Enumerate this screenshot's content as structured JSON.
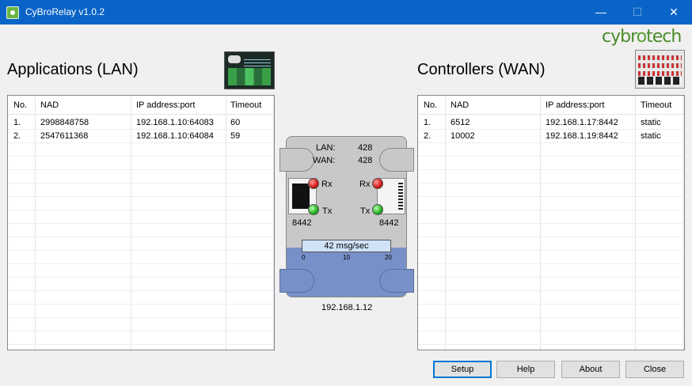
{
  "window": {
    "title": "CyBroRelay v1.0.2",
    "minimize": "—",
    "maximize": "☐",
    "close": "✕"
  },
  "brand": {
    "logo_a": "cybr",
    "logo_o": "o",
    "logo_b": "tech"
  },
  "lan": {
    "title": "Applications (LAN)",
    "columns": [
      "No.",
      "NAD",
      "IP address:port",
      "Timeout"
    ],
    "rows": [
      [
        "1.",
        "2998848758",
        "192.168.1.10:64083",
        "60"
      ],
      [
        "2.",
        "2547611368",
        "192.168.1.10:64084",
        "59"
      ]
    ]
  },
  "wan": {
    "title": "Controllers (WAN)",
    "columns": [
      "No.",
      "NAD",
      "IP address:port",
      "Timeout"
    ],
    "rows": [
      [
        "1.",
        "6512",
        "192.168.1.17:8442",
        "static"
      ],
      [
        "2.",
        "10002",
        "192.168.1.19:8442",
        "static"
      ]
    ]
  },
  "device": {
    "lan_label": "LAN:",
    "lan_value": "428",
    "wan_label": "WAN:",
    "wan_value": "428",
    "rx": "Rx",
    "tx": "Tx",
    "port_left": "8442",
    "port_right": "8442",
    "rate": "42 msg/sec",
    "rate_fraction": 0.42,
    "scale": [
      "0",
      "10",
      "20"
    ],
    "ip": "192.168.1.12"
  },
  "buttons": {
    "setup": "Setup",
    "help": "Help",
    "about": "About",
    "close": "Close"
  }
}
